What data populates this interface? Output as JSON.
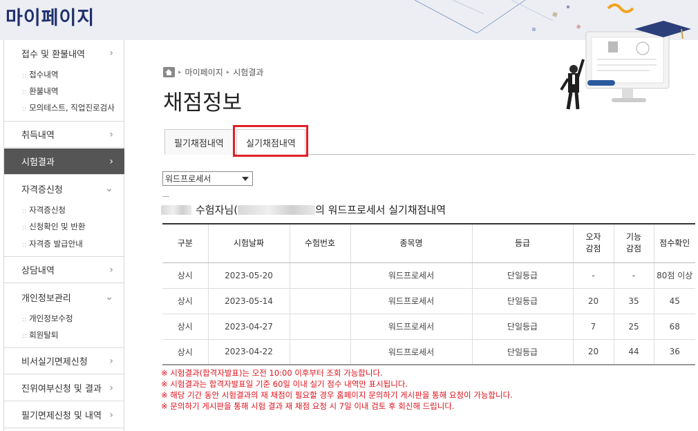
{
  "header": {
    "title": "마이페이지"
  },
  "sidebar": {
    "groups": [
      {
        "label": "접수 및 환불내역",
        "subs": [
          "접수내역",
          "환불내역",
          "모의테스트, 직업진로검사"
        ]
      },
      {
        "label": "취득내역"
      },
      {
        "label": "시험결과",
        "active": true
      },
      {
        "label": "자격증신청",
        "subs": [
          "자격증신청",
          "신청확인 및 반환",
          "자격증 발급안내"
        ]
      },
      {
        "label": "상담내역"
      },
      {
        "label": "개인정보관리",
        "subs": [
          "개인정보수정",
          "회원탈퇴"
        ]
      },
      {
        "label": "비서실기면제신청"
      },
      {
        "label": "진위여부신청 및 결과"
      },
      {
        "label": "필기면제신청 및 내역"
      }
    ]
  },
  "breadcrumb": {
    "items": [
      "마이페이지",
      "시험결과"
    ]
  },
  "page_title": "채점정보",
  "tabs": [
    {
      "label": "필기채점내역"
    },
    {
      "label": "실기채점내역",
      "active": true
    }
  ],
  "subject_select": {
    "value": "워드프로세서"
  },
  "subject_line": {
    "suffix": "수험자님(",
    "suffix2": "의 워드프로세서 실기채점내역"
  },
  "table": {
    "headers": [
      "구분",
      "시험날짜",
      "수험번호",
      "종목명",
      "등급",
      "오자\n감점",
      "기능\n감점",
      "점수확인"
    ],
    "rows": [
      [
        "상시",
        "2023-05-20",
        "",
        "워드프로세서",
        "단일등급",
        "-",
        "-",
        "80점 이상"
      ],
      [
        "상시",
        "2023-05-14",
        "",
        "워드프로세서",
        "단일등급",
        "20",
        "35",
        "45"
      ],
      [
        "상시",
        "2023-04-27",
        "",
        "워드프로세서",
        "단일등급",
        "7",
        "25",
        "68"
      ],
      [
        "상시",
        "2023-04-22",
        "",
        "워드프로세서",
        "단일등급",
        "20",
        "44",
        "36"
      ]
    ]
  },
  "notices": [
    "※ 시험결과(합격자발표)는 오전 10:00 이후부터 조회 가능합니다.",
    "※ 시험결과는 합격자발표일 기준 60일 이내 실기 점수 내역만 표시됩니다.",
    "※ 해당 기간 동안 시험결과의 재 채점이 필요할 경우 홈페이지 문의하기 게시판을 통해 요청이 가능합니다.",
    "※ 문의하기 게시판을 통해 시험 결과 재 채점 요청 시 7일 이내 검토 후 회신해 드립니다."
  ],
  "colors": {
    "title_navy": "#1f2f6e",
    "active_side": "#555555",
    "highlight_red": "#e21f26",
    "notice_red": "#e0111b"
  }
}
